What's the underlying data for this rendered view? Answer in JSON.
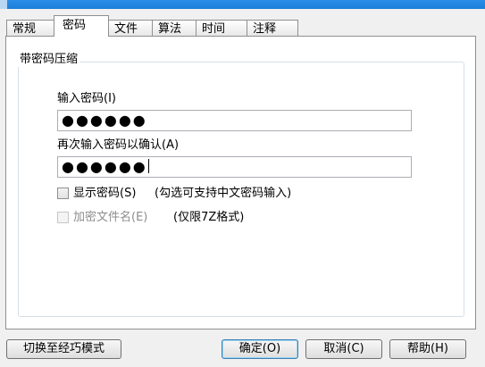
{
  "tabs": [
    {
      "label": "常规"
    },
    {
      "label": "密码"
    },
    {
      "label": "文件"
    },
    {
      "label": "算法"
    },
    {
      "label": "时间"
    },
    {
      "label": "注释"
    }
  ],
  "active_tab": "密码",
  "group": {
    "title": "带密码压缩"
  },
  "password": {
    "label": "输入密码(I)",
    "value": "●●●●●●"
  },
  "confirm": {
    "label": "再次输入密码以确认(A)",
    "value": "●●●●●●"
  },
  "show_password": {
    "label": "显示密码(S)",
    "hint": "(勾选可支持中文密码输入)",
    "checked": false
  },
  "encrypt_names": {
    "label": "加密文件名(E)",
    "hint": "(仅限7Z格式)",
    "checked": false,
    "disabled": true
  },
  "buttons": {
    "switch_mode": "切换至经巧模式",
    "ok": "确定(O)",
    "cancel": "取消(C)",
    "help": "帮助(H)"
  }
}
